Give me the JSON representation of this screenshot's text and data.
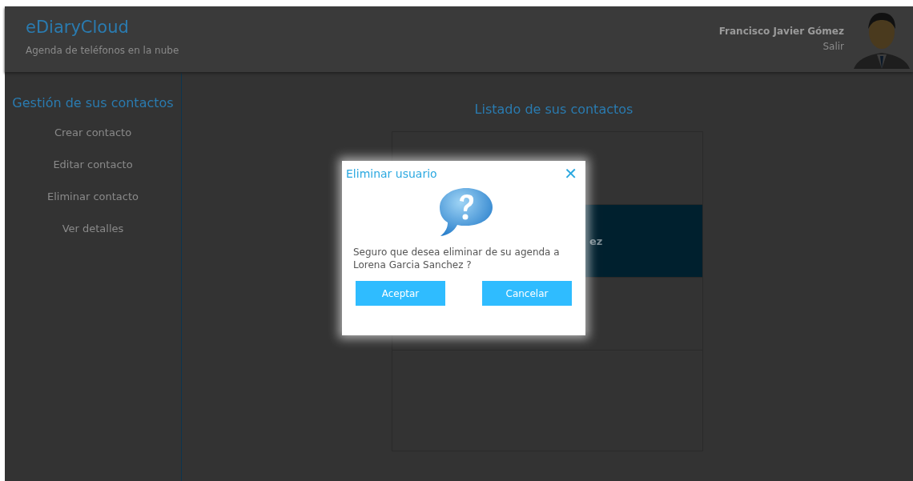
{
  "header": {
    "app_name": "eDiaryCloud",
    "tagline": "Agenda de teléfonos en la nube",
    "user_name": "Francisco Javier Gómez",
    "logout": "Salir"
  },
  "sidebar": {
    "title": "Gestión de sus contactos",
    "items": [
      {
        "label": "Crear contacto"
      },
      {
        "label": "Editar contacto"
      },
      {
        "label": "Eliminar contacto"
      },
      {
        "label": "Ver detalles"
      }
    ]
  },
  "main": {
    "title": "Listado de sus contactos",
    "contacts": [
      {
        "selected": false
      },
      {
        "name_visible": "ez",
        "selected": true
      },
      {
        "selected": false
      }
    ]
  },
  "dialog": {
    "title": "Eliminar usuario",
    "close": "✕",
    "message": "Seguro que desea eliminar de su agenda a Lorena Garcia Sanchez ?",
    "buttons": [
      "Aceptar",
      "Cancelar"
    ]
  }
}
